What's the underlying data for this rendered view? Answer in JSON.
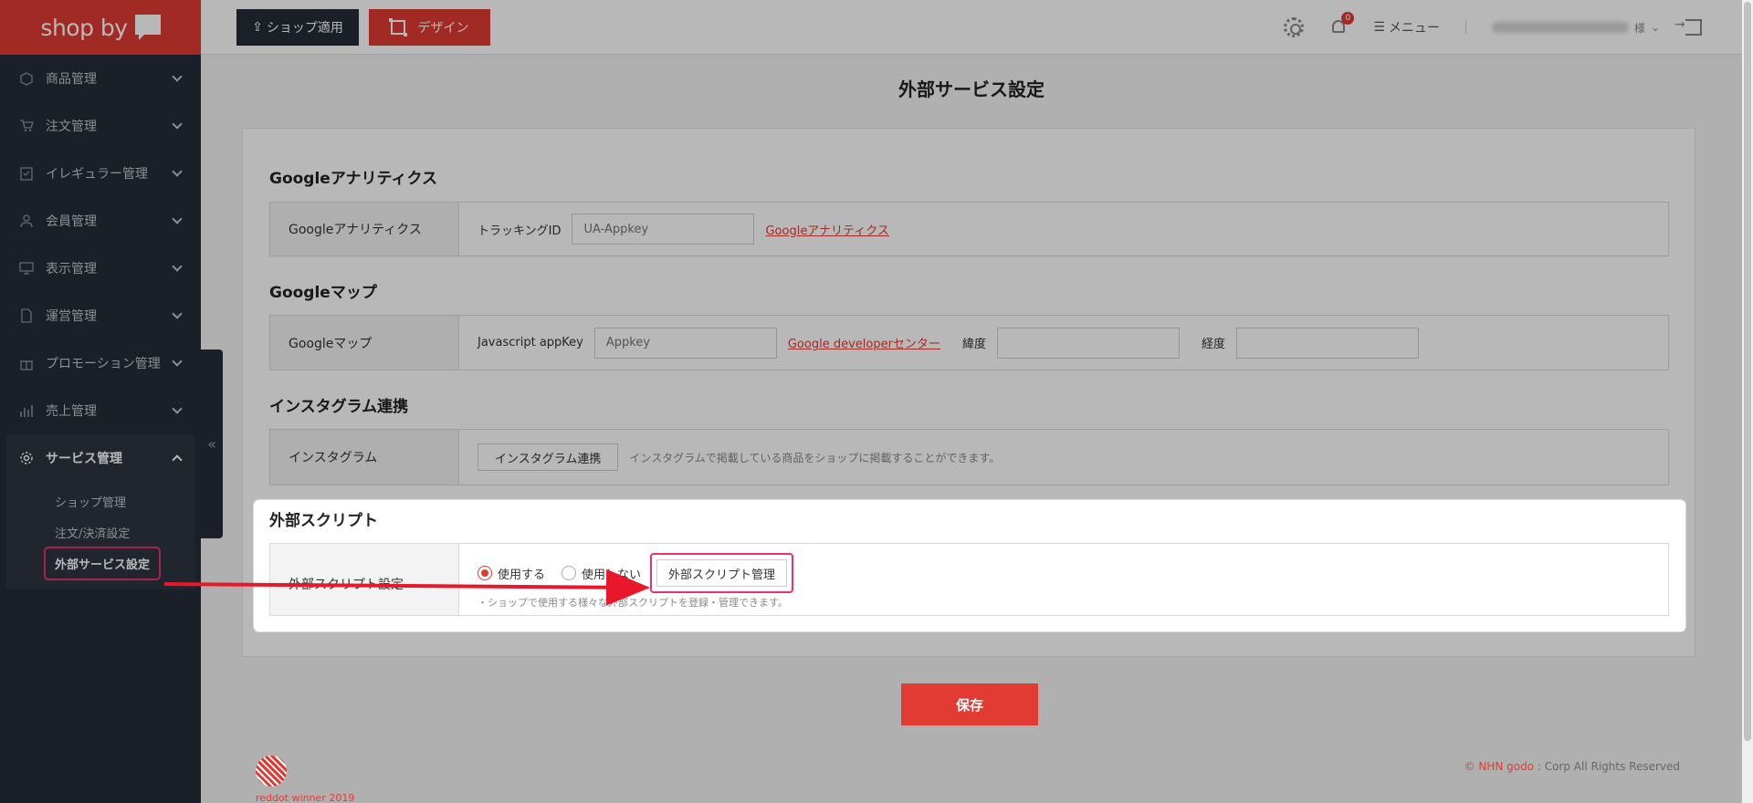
{
  "brand": {
    "logo_text": "shop by"
  },
  "sidebar": {
    "items": [
      {
        "label": "商品管理",
        "icon": "box-icon"
      },
      {
        "label": "注文管理",
        "icon": "cart-icon"
      },
      {
        "label": "イレギュラー管理",
        "icon": "clipboard-icon"
      },
      {
        "label": "会員管理",
        "icon": "user-icon"
      },
      {
        "label": "表示管理",
        "icon": "monitor-icon"
      },
      {
        "label": "運営管理",
        "icon": "document-icon"
      },
      {
        "label": "プロモーション管理",
        "icon": "gift-icon"
      },
      {
        "label": "売上管理",
        "icon": "chart-icon"
      }
    ],
    "active_group": {
      "label": "サービス管理",
      "icon": "gear-icon",
      "sub_items": [
        "ショップ管理",
        "注文/決済設定",
        "外部サービス設定"
      ]
    }
  },
  "toolbar": {
    "shop_apply": "ショップ適用",
    "design": "デザイン",
    "menu": "メニュー",
    "notification_count": "0",
    "user_suffix": "様"
  },
  "page": {
    "title": "外部サービス設定"
  },
  "sections": {
    "ga": {
      "heading": "Googleアナリティクス",
      "row_label": "Googleアナリティクス",
      "field_label": "トラッキングID",
      "placeholder": "UA-Appkey",
      "link": "Googleアナリティクス"
    },
    "maps": {
      "heading": "Googleマップ",
      "row_label": "Googleマップ",
      "field_label": "Javascript appKey",
      "placeholder": "Appkey",
      "link": "Google developerセンター",
      "lat_label": "緯度",
      "lng_label": "経度"
    },
    "insta": {
      "heading": "インスタグラム連携",
      "row_label": "インスタグラム",
      "button": "インスタグラム連携",
      "hint": "インスタグラムで掲載している商品をショップに掲載することができます。"
    },
    "script": {
      "heading": "外部スクリプト",
      "row_label": "外部スクリプト設定",
      "radio_on": "使用する",
      "radio_off": "使用しない",
      "button": "外部スクリプト管理",
      "hint": "・ショップで使用する様々な外部スクリプトを登録・管理できます。"
    }
  },
  "actions": {
    "save": "保存"
  },
  "footer": {
    "award_text_red": "reddot",
    "award_text": " winner 2019",
    "nhn": "© NHN godo",
    "rights": " : Corp All Rights Reserved"
  }
}
